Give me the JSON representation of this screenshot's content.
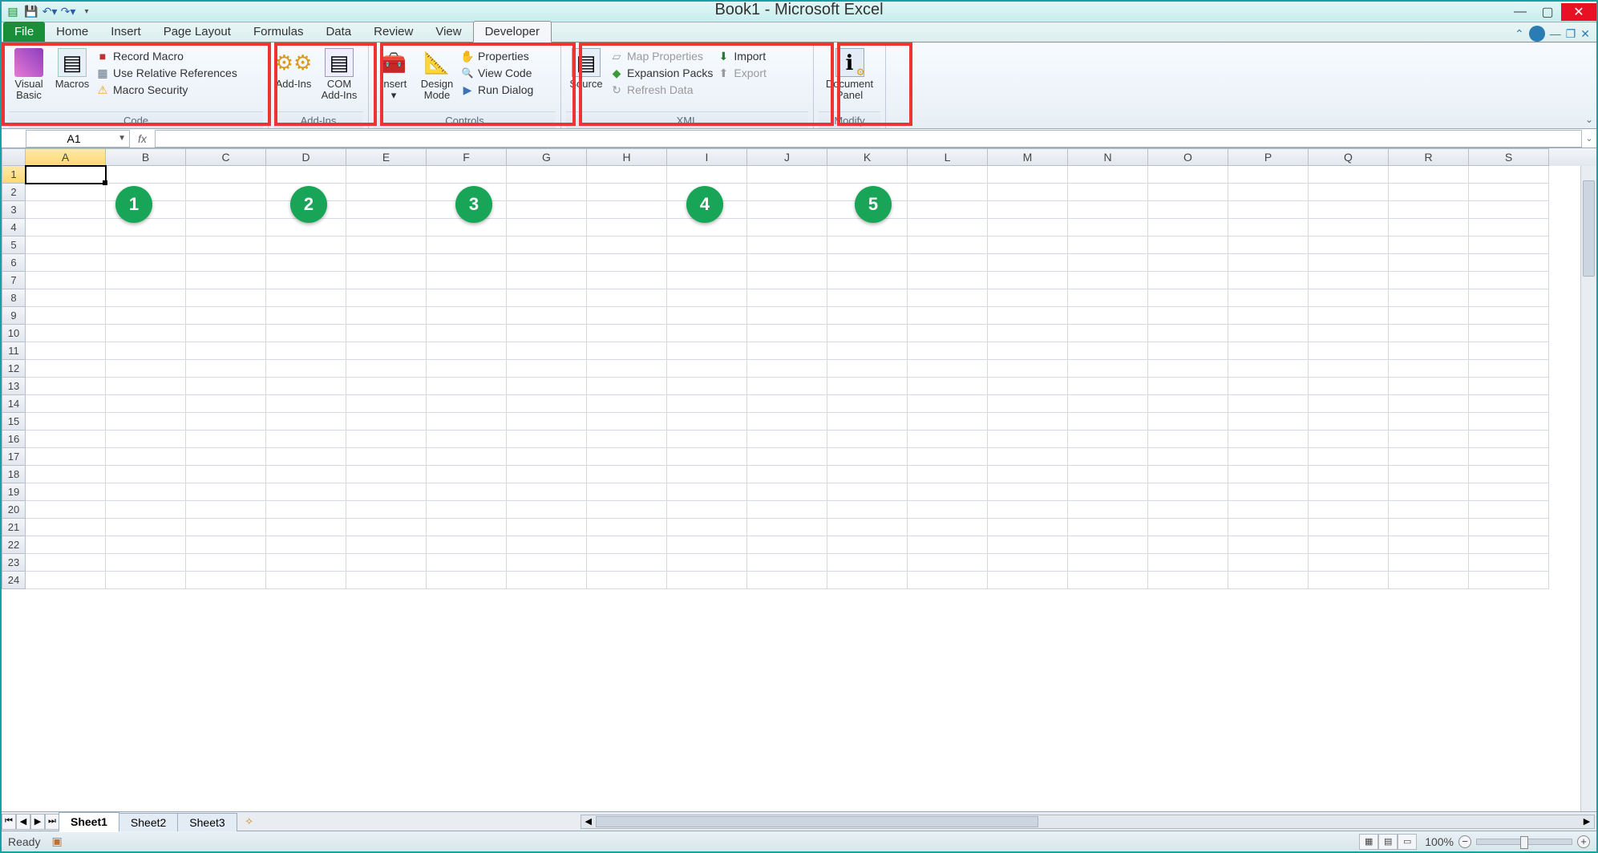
{
  "window": {
    "title": "Book1 - Microsoft Excel"
  },
  "tabs": {
    "file": "File",
    "items": [
      "Home",
      "Insert",
      "Page Layout",
      "Formulas",
      "Data",
      "Review",
      "View",
      "Developer"
    ],
    "active": "Developer"
  },
  "ribbon": {
    "code": {
      "label": "Code",
      "visual_basic": "Visual\nBasic",
      "macros": "Macros",
      "record_macro": "Record Macro",
      "use_relative": "Use Relative References",
      "macro_security": "Macro Security"
    },
    "addins": {
      "label": "Add-Ins",
      "addins": "Add-Ins",
      "com_addins": "COM\nAdd-Ins"
    },
    "controls": {
      "label": "Controls",
      "insert": "Insert",
      "design_mode": "Design\nMode",
      "properties": "Properties",
      "view_code": "View Code",
      "run_dialog": "Run Dialog"
    },
    "xml": {
      "label": "XML",
      "source": "Source",
      "map_properties": "Map Properties",
      "expansion_packs": "Expansion Packs",
      "refresh_data": "Refresh Data",
      "import": "Import",
      "export": "Export"
    },
    "modify": {
      "label": "Modify",
      "document_panel": "Document\nPanel"
    }
  },
  "formula_bar": {
    "name_box": "A1",
    "fx": "fx"
  },
  "columns": [
    "A",
    "B",
    "C",
    "D",
    "E",
    "F",
    "G",
    "H",
    "I",
    "J",
    "K",
    "L",
    "M",
    "N",
    "O",
    "P",
    "Q",
    "R",
    "S"
  ],
  "rows": [
    1,
    2,
    3,
    4,
    5,
    6,
    7,
    8,
    9,
    10,
    11,
    12,
    13,
    14,
    15,
    16,
    17,
    18,
    19,
    20,
    21,
    22,
    23,
    24
  ],
  "active_cell": "A1",
  "sheets": {
    "items": [
      "Sheet1",
      "Sheet2",
      "Sheet3"
    ],
    "active": "Sheet1"
  },
  "status": {
    "ready": "Ready",
    "zoom": "100%"
  },
  "annotations": [
    "1",
    "2",
    "3",
    "4",
    "5"
  ]
}
